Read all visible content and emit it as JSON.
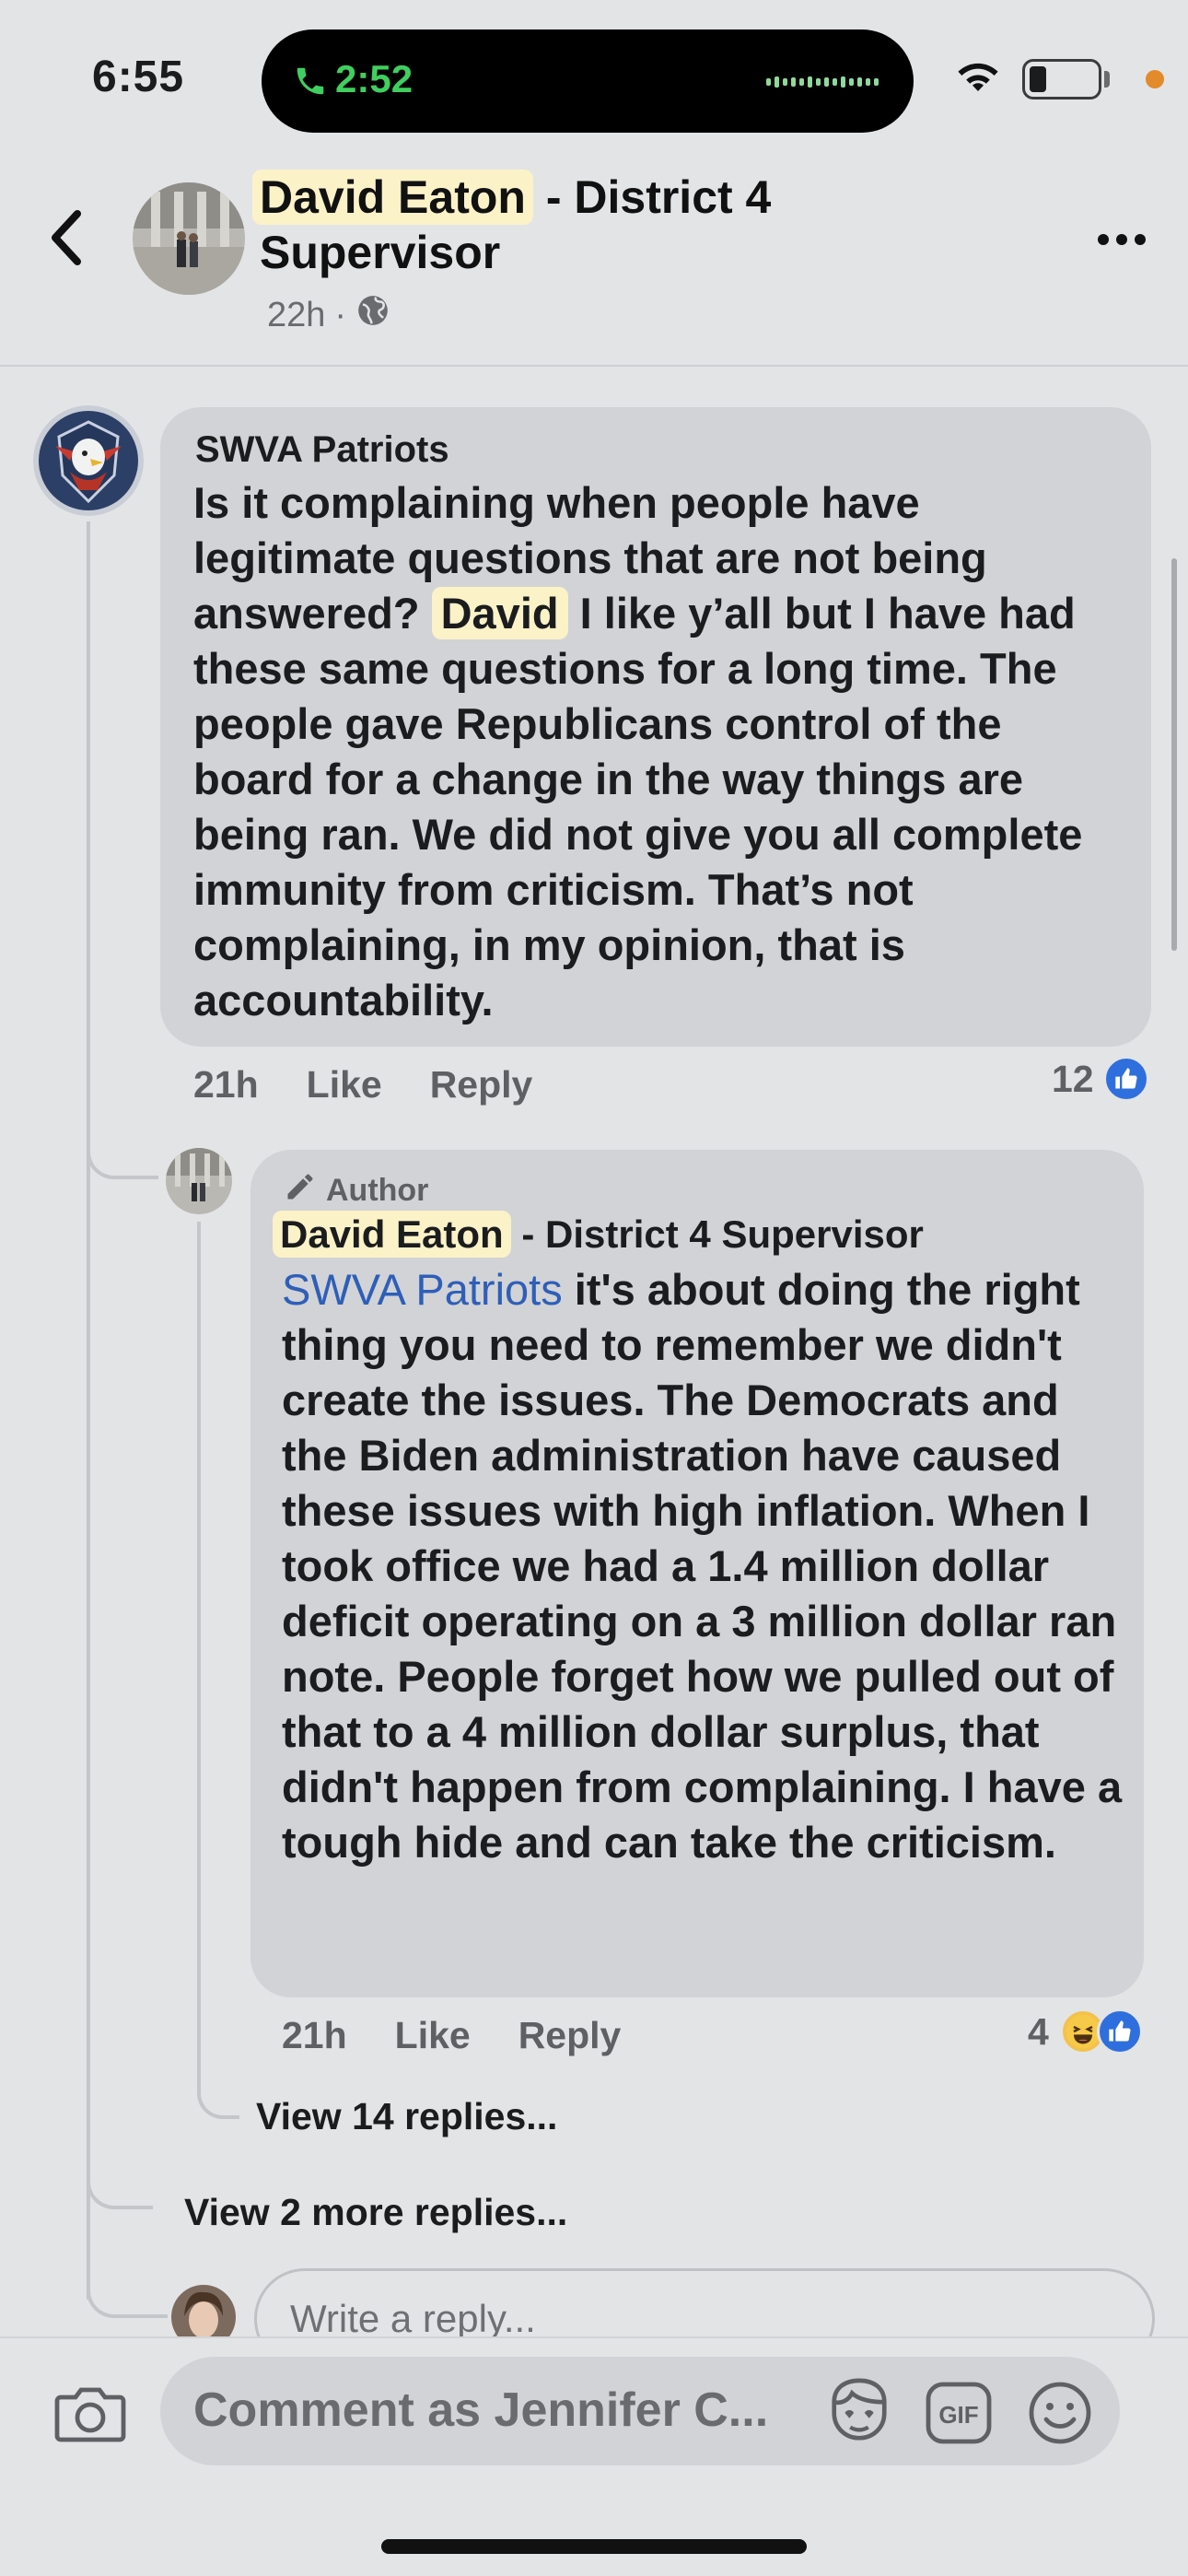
{
  "status_bar": {
    "time": "6:55",
    "call_duration": "2:52",
    "call_color": "#3fcf5f",
    "icons": [
      "phone-icon",
      "wifi-icon",
      "battery-icon"
    ]
  },
  "header": {
    "highlighted_name": "David Eaton",
    "title_suffix": " - District 4",
    "title_line2": "Supervisor",
    "time_ago": "22h",
    "separator": "·",
    "privacy_icon": "globe-icon",
    "more_icon": "more-icon"
  },
  "comment_1": {
    "author": "SWVA Patriots",
    "text_before_highlight": "Is it complaining when people have legitimate questions that are not being answered? ",
    "highlight": "David",
    "text_after_highlight": " I like y’all but I have had these same questions for a long time. The people gave Republicans control of the board for a change in the way things are being ran. We did not give you all complete immunity from criticism. That’s not complaining, in my opinion, that is accountability.",
    "time": "21h",
    "like_label": "Like",
    "reply_label": "Reply",
    "reaction_count": "12"
  },
  "comment_2": {
    "badge": "Author",
    "highlighted_name": "David Eaton",
    "name_suffix": " - District 4 Supervisor",
    "mention": "SWVA Patriots",
    "text": " it's about doing the right thing you need to remember we didn't create the issues. The Democrats and the Biden administration have caused these issues with high inflation. When I took office we had a 1.4 million dollar deficit operating on a 3 million dollar ran note. People forget how we pulled out of that to a 4 million dollar surplus, that didn't happen from complaining. I have a tough hide and can take the criticism.",
    "time": "21h",
    "like_label": "Like",
    "reply_label": "Reply",
    "reaction_count": "4"
  },
  "view_replies": "View 14 replies...",
  "view_more_replies": "View 2 more replies...",
  "reply_placeholder": "Write a reply...",
  "composer": {
    "placeholder": "Comment as Jennifer C...",
    "gif_label": "GIF"
  },
  "colors": {
    "background": "#e3e4e6",
    "bubble": "#d2d3d6",
    "highlight": "#fbf2c8",
    "mention": "#2e5fb8",
    "like_blue": "#2f6fdd"
  }
}
